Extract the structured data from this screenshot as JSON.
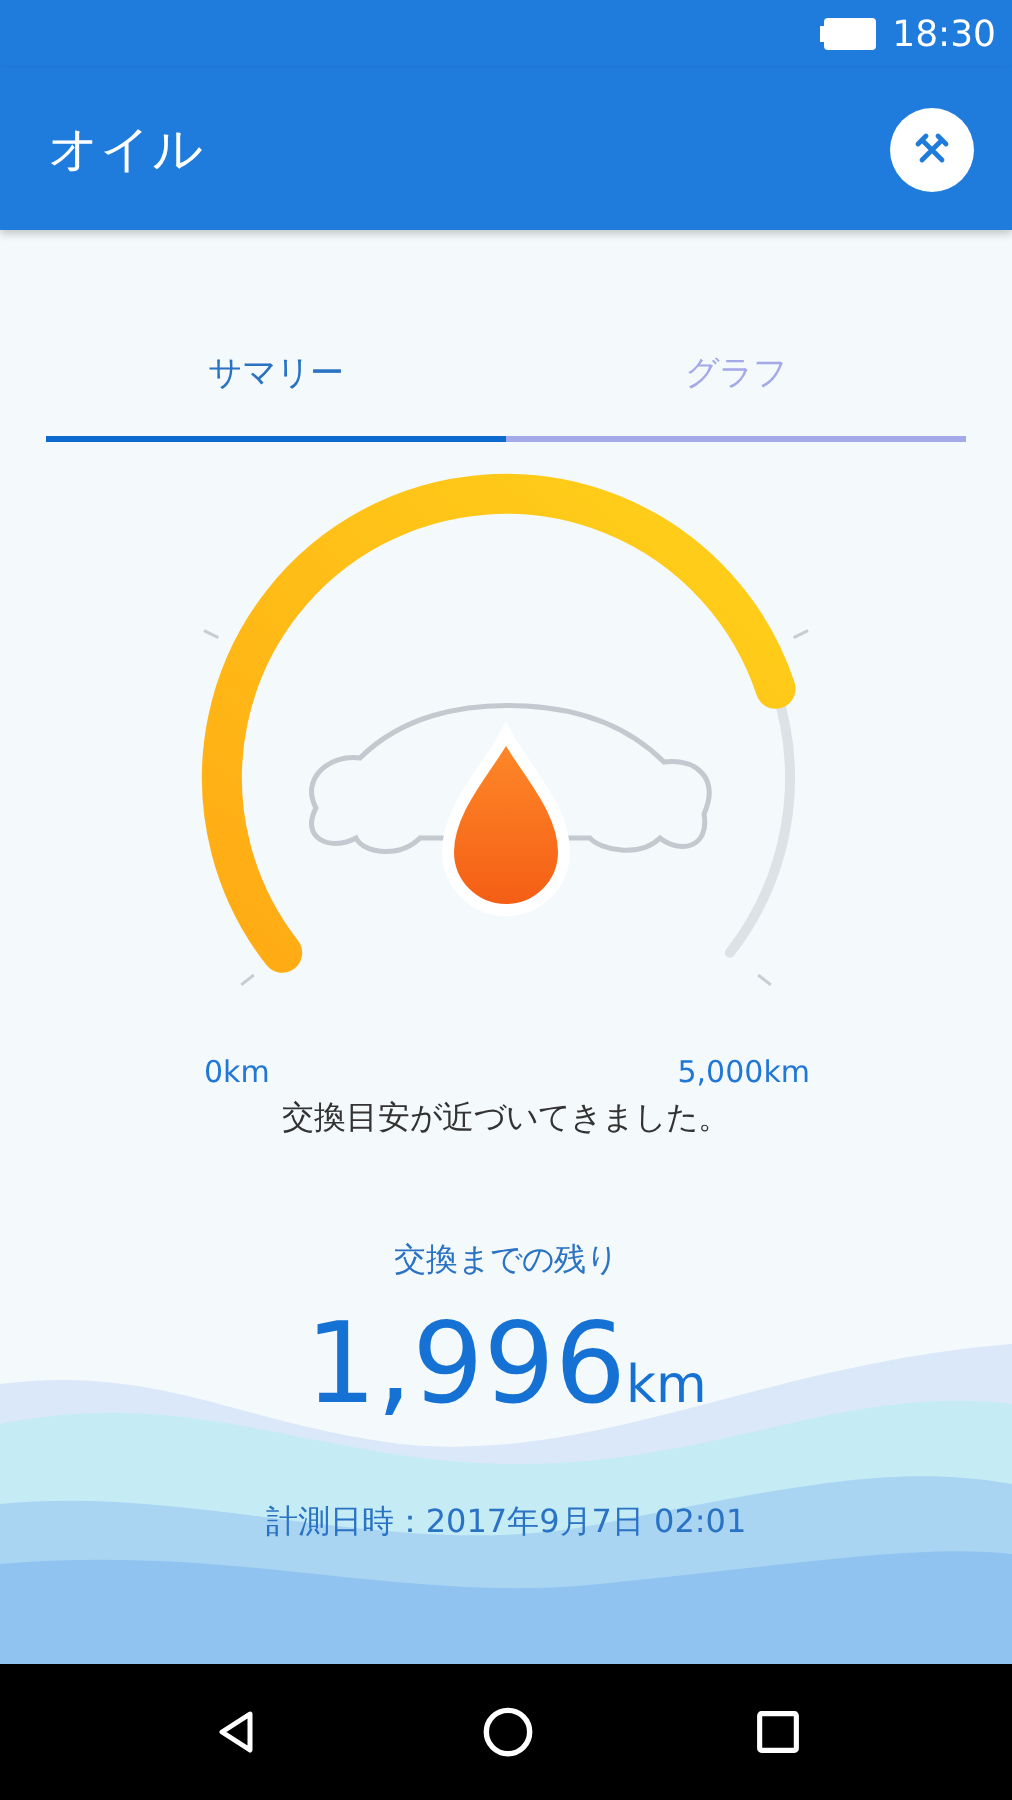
{
  "status_bar": {
    "time": "18:30"
  },
  "app_bar": {
    "title": "オイル"
  },
  "tabs": [
    {
      "label": "サマリー",
      "selected": true
    },
    {
      "label": "グラフ",
      "selected": false
    }
  ],
  "gauge": {
    "min_label": "0km",
    "max_label": "5,000km",
    "message": "交換目安が近づいてきました。"
  },
  "remaining": {
    "label": "交換までの残り",
    "value": "1,996",
    "unit": "km"
  },
  "measured": "計測日時：2017年9月7日 02:01"
}
